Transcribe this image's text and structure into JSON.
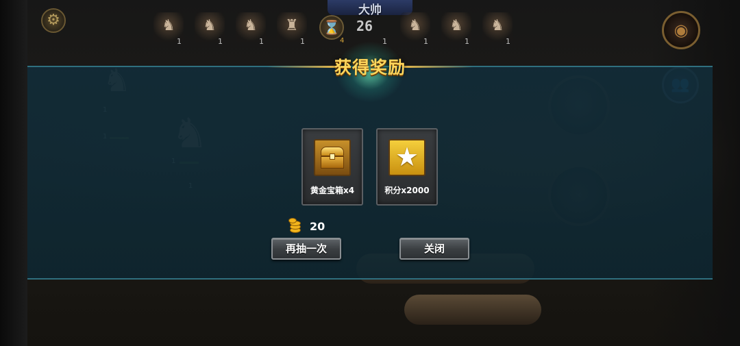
{
  "top_bar": {
    "rank_title": "大帅",
    "timer": "26",
    "unit_counts": [
      "1",
      "1",
      "1",
      "1",
      "1",
      "1",
      "1",
      "1"
    ],
    "small_badge": "4"
  },
  "battlefield": {
    "unit_counts": [
      "1",
      "1",
      "1",
      "1"
    ]
  },
  "reward_dialog": {
    "title": "获得奖励",
    "items": [
      {
        "label": "黄金宝箱x4",
        "icon": "treasure-chest-icon"
      },
      {
        "label": "积分x2000",
        "icon": "star-icon"
      }
    ],
    "cost_value": "20",
    "retry_label": "再抽一次",
    "close_label": "关闭"
  },
  "colors": {
    "title_gold": "#ffd65c",
    "band_teal": "#122c38",
    "button_gray": "#3c4043"
  }
}
